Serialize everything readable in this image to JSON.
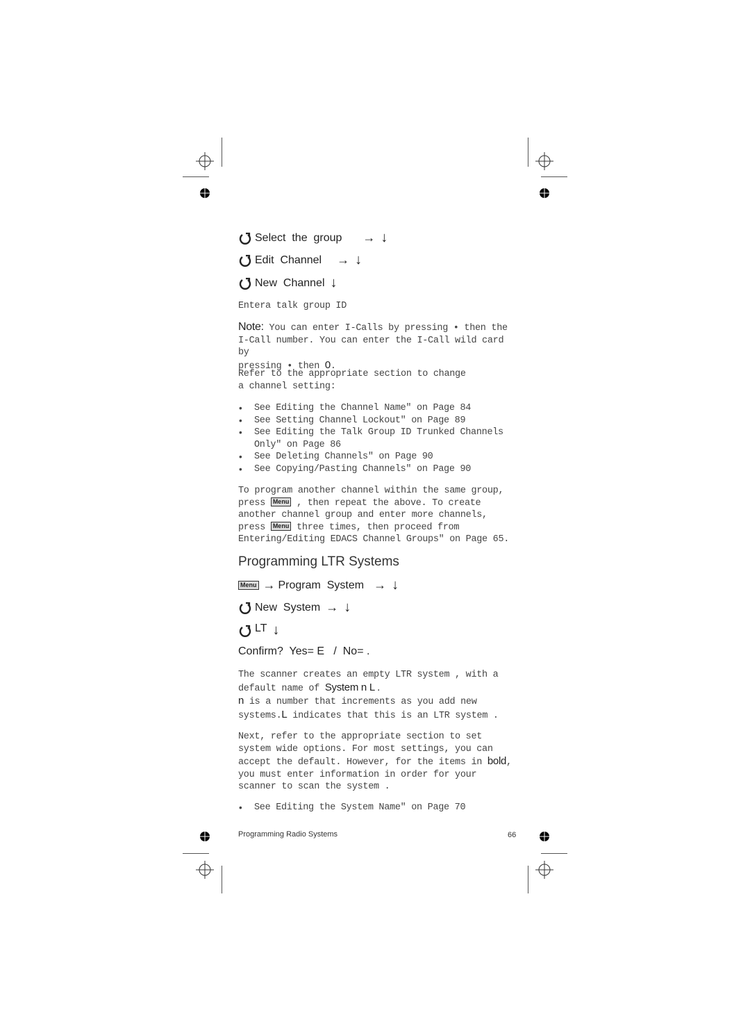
{
  "steps_top": [
    {
      "label": "Select  the  group",
      "arrow": "→",
      "down": "↓"
    },
    {
      "label": "Edit  Channel",
      "arrow": "→",
      "down": "↓"
    },
    {
      "label": "New  Channel",
      "arrow": "",
      "down": "↓"
    }
  ],
  "enter_talkgroup": "Entera talk group ID",
  "note": {
    "label": "Note:",
    "line1": " You can enter I-Calls by pressing  •   then the",
    "line2": "I-Call number. You can enter the I-Call wild card by",
    "line3_pre": "pressing  •  then ",
    "line3_key": "0",
    "line3_post": "."
  },
  "refer_text": "Refer to the appropriate section to change a channel setting:",
  "channel_links": [
    "See  Editing the Channel Name\" on Page 84",
    "See  Setting Channel Lockout\" on Page 89",
    "See  Editing the Talk Group ID  Trunked Channels Only\" on Page 86",
    "See  Deleting Channels\" on Page 90",
    "See  Copying/Pasting Channels\" on Page 90"
  ],
  "program_another": {
    "part1": "To program  another channel within the same group, press ",
    "menu_key": "Menu",
    "part2": " , then repeat the above. To create another channel group and enter more channels, press ",
    "part3": " three times, then proceed from  Entering/Editing EDACS Channel Groups\" on Page 65."
  },
  "section_heading": "Programming LTR Systems",
  "steps_ltr": [
    {
      "prefix_key": "Menu",
      "label": "Program  System",
      "arrow": "→",
      "down": "↓"
    },
    {
      "label": "New  System",
      "arrow": "→",
      "down": "↓"
    },
    {
      "label": "LT",
      "arrow": "",
      "down": "↓"
    }
  ],
  "confirm": "Confirm?  Yes= E   /  No= .",
  "scanner_creates": {
    "part1": "The scanner creates an empty LTR system , with a default name of ",
    "bold": "System  n          L  .",
    "n": "n",
    "part2": " is a number that increments as you add new systems.",
    "L": "L",
    "part3": " indicates that this is an LTR system ."
  },
  "next_text": {
    "part1": "Next, refer to the appropriate section to set system wide options. For most settings, you can accept the default. However, for the items in ",
    "bold": "bold",
    "part2": ", you must enter information in order for your scanner to scan the system ."
  },
  "system_links": [
    "See  Editing the System Name\" on Page 70"
  ],
  "footer": {
    "chapter": "Programming Radio Systems",
    "page_number": "66"
  }
}
